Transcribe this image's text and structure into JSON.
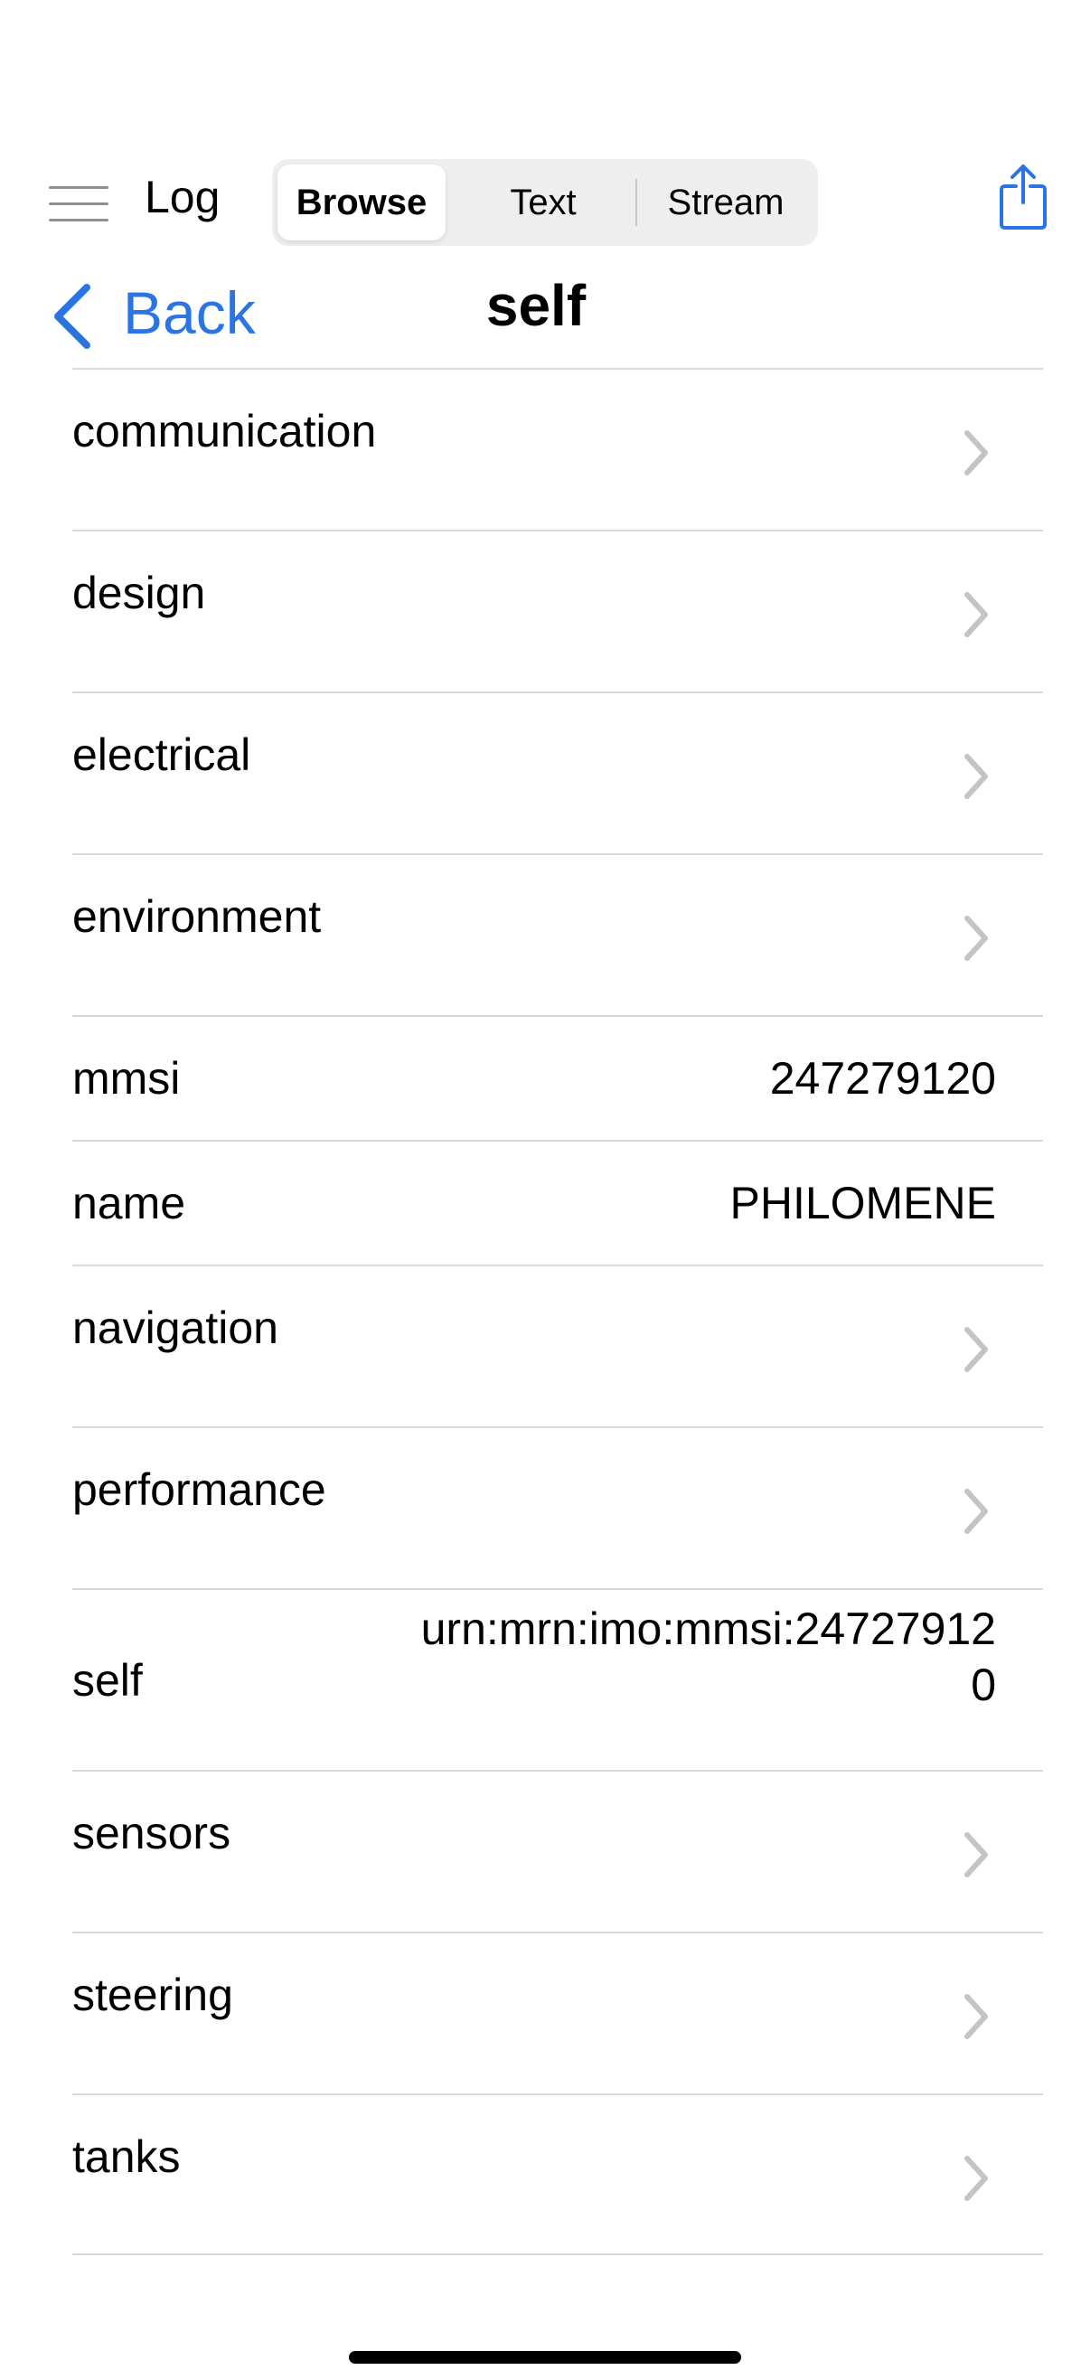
{
  "toolbar": {
    "menu_icon": "hamburger-menu-icon",
    "log_label": "Log",
    "segments": [
      "Browse",
      "Text",
      "Stream"
    ],
    "selected_segment": "Browse",
    "share_icon": "share-icon"
  },
  "navbar": {
    "back_label": "Back",
    "title": "self"
  },
  "colors": {
    "accent": "#2b74e4",
    "separator": "#d9d9dc",
    "chevron": "#c4c4c7",
    "segment_bg": "#eeeeef"
  },
  "rows": [
    {
      "label": "communication",
      "kind": "link"
    },
    {
      "label": "design",
      "kind": "link"
    },
    {
      "label": "electrical",
      "kind": "link"
    },
    {
      "label": "environment",
      "kind": "link"
    },
    {
      "label": "mmsi",
      "kind": "value",
      "value": "247279120"
    },
    {
      "label": "name",
      "kind": "value",
      "value": "PHILOMENE"
    },
    {
      "label": "navigation",
      "kind": "link"
    },
    {
      "label": "performance",
      "kind": "link"
    },
    {
      "label": "self",
      "kind": "value",
      "value": "urn:mrn:imo:mmsi:247279120"
    },
    {
      "label": "sensors",
      "kind": "link"
    },
    {
      "label": "steering",
      "kind": "link"
    },
    {
      "label": "tanks",
      "kind": "link"
    }
  ]
}
